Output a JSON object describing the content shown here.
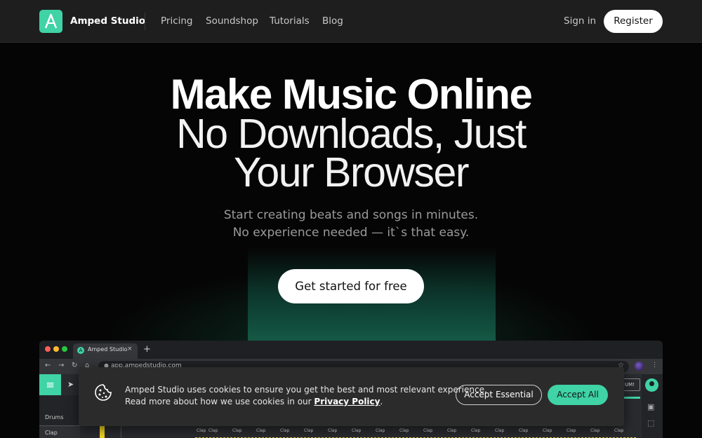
{
  "nav": {
    "brand": "Amped Studio",
    "links": [
      "Pricing",
      "Soundshop",
      "Tutorials",
      "Blog"
    ],
    "sign_in": "Sign in",
    "register": "Register"
  },
  "hero": {
    "line1": "Make Music Online",
    "line2": "No Downloads, Just",
    "line3": "Your Browser",
    "sub1": "Start creating beats and songs in minutes.",
    "sub2": "No experience needed — it`s that easy.",
    "cta": "Get started for free"
  },
  "app_preview": {
    "tab_title": "Amped Studio",
    "tab_icon_letter": "A",
    "tab_close": "×",
    "new_tab": "+",
    "url": "app.ampedstudio.com",
    "track_group": "Drums",
    "track_name": "Clap",
    "clip_label": "Clap",
    "tag": "UM!",
    "nav_back": "←",
    "nav_forward": "→",
    "nav_reload": "↻",
    "nav_home": "⌂",
    "menu_icon": "≡",
    "cursor_icon": "➤",
    "star": "☆",
    "kebab": "⋮"
  },
  "cookie": {
    "text1": "Amped Studio uses cookies to ensure you get the best and most relevant experience.",
    "text2_prefix": "Read more about how we use cookies in our ",
    "link": "Privacy Policy",
    "text2_suffix": ".",
    "accept_essential": "Accept Essential",
    "accept_all": "Accept All"
  },
  "colors": {
    "accent": "#3fd3a5",
    "nav_bg": "#1e1e1e",
    "page_bg": "#050505",
    "cookie_bg": "#2b2b2b"
  }
}
